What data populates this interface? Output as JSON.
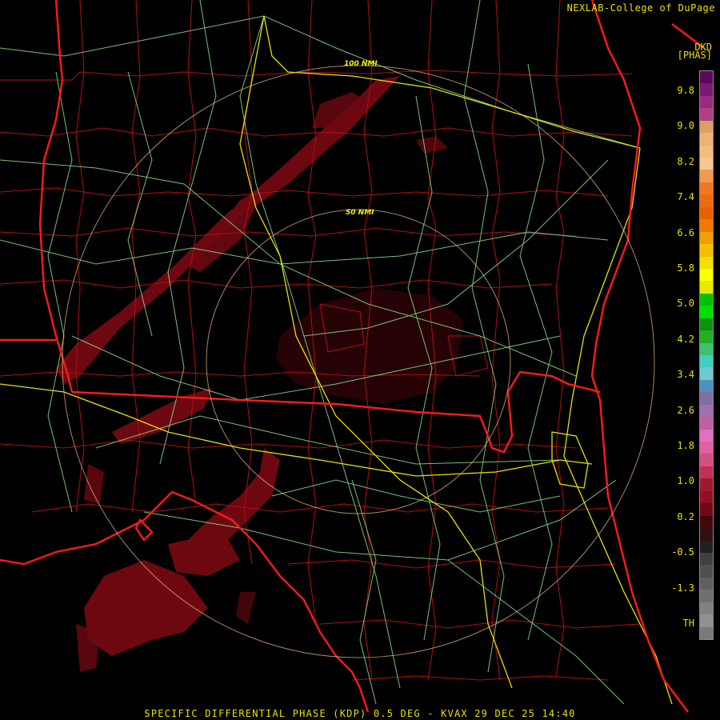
{
  "credit": "NEXLAB-College of DuPage",
  "legend": {
    "line1": "DKD",
    "line2": "[PHAS]",
    "ticks": [
      "9.8",
      "9.0",
      "8.2",
      "7.4",
      "6.6",
      "5.8",
      "5.0",
      "4.2",
      "3.4",
      "2.6",
      "1.8",
      "1.0",
      "0.2",
      "-0.5",
      "-1.3",
      "TH"
    ],
    "colors": [
      "#5a0a5a",
      "#7a1a70",
      "#9a2a80",
      "#b04080",
      "#d9a066",
      "#f0b07a",
      "#f4bc80",
      "#f5c890",
      "#f09a50",
      "#f07820",
      "#ec6a10",
      "#e86000",
      "#f07a00",
      "#f2a000",
      "#f5c000",
      "#f5e000",
      "#ffff00",
      "#e8e800",
      "#00c000",
      "#00e000",
      "#109010",
      "#20b020",
      "#40c070",
      "#40d0c0",
      "#70c8d0",
      "#5090c0",
      "#8070a0",
      "#a070b0",
      "#c060a0",
      "#e070c0",
      "#e060a0",
      "#d05080",
      "#c03050",
      "#a01830",
      "#901020",
      "#700818",
      "#400808",
      "#301010",
      "#202020",
      "#404040",
      "#505050",
      "#606060",
      "#707070",
      "#808080",
      "#909090",
      "#7a7a7a"
    ]
  },
  "rings": {
    "inner_label": "50 NMI",
    "outer_label": "100 NMI"
  },
  "caption": "SPECIFIC DIFFERENTIAL PHASE (KDP) 0.5 DEG - KVAX 29 DEC 25 14:40"
}
